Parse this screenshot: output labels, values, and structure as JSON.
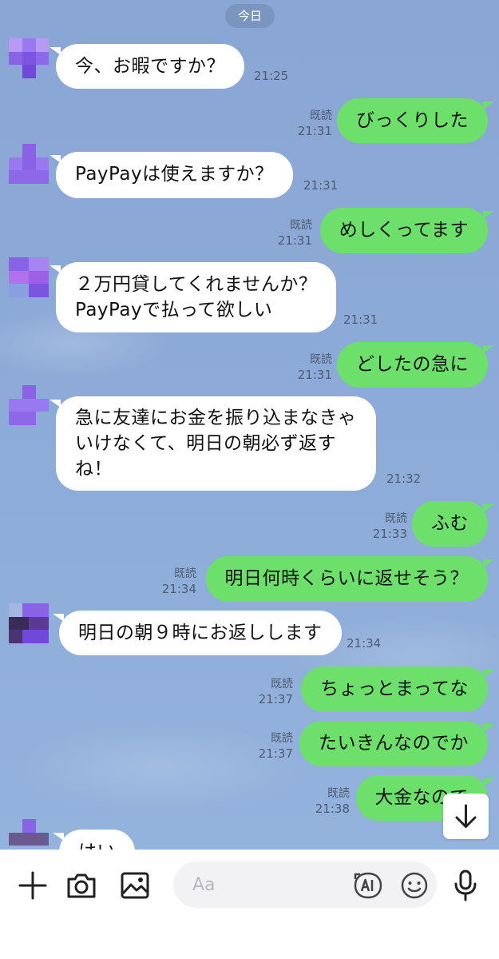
{
  "date_label": "今日",
  "messages": [
    {
      "side": "in",
      "text": [
        "今、お暇ですか？"
      ],
      "time": "21:25"
    },
    {
      "side": "out",
      "text": [
        "びっくりした"
      ],
      "read": "既読",
      "time": "21:31"
    },
    {
      "side": "in",
      "text": [
        "PayPayは使えますか？"
      ],
      "time": "21:31"
    },
    {
      "side": "out",
      "text": [
        "めしくってます"
      ],
      "read": "既読",
      "time": "21:31"
    },
    {
      "side": "in",
      "text": [
        "２万円貸してくれませんか？",
        "PayPayで払って欲しい"
      ],
      "time": "21:31"
    },
    {
      "side": "out",
      "text": [
        "どしたの急に"
      ],
      "read": "既読",
      "time": "21:31"
    },
    {
      "side": "in",
      "text": [
        "急に友達にお金を振り込まなきゃ",
        "いけなくて、明日の朝必ず返す",
        "ね！"
      ],
      "time": "21:32"
    },
    {
      "side": "out",
      "text": [
        "ふむ"
      ],
      "read": "既読",
      "time": "21:33"
    },
    {
      "side": "out",
      "text": [
        "明日何時くらいに返せそう？"
      ],
      "read": "既読",
      "time": "21:34"
    },
    {
      "side": "in",
      "text": [
        "明日の朝９時にお返しします"
      ],
      "time": "21:34"
    },
    {
      "side": "out",
      "text": [
        "ちょっとまってな"
      ],
      "read": "既読",
      "time": "21:37"
    },
    {
      "side": "out",
      "text": [
        "たいきんなのでか"
      ],
      "read": "既読",
      "time": "21:37"
    },
    {
      "side": "out",
      "text": [
        "大金なので"
      ],
      "read": "既読",
      "time": "21:38"
    },
    {
      "side": "in",
      "text": [
        "はい"
      ],
      "time": ""
    }
  ],
  "input": {
    "placeholder": "Aa"
  },
  "icons": {
    "plus": "plus-icon",
    "camera": "camera-icon",
    "image": "image-icon",
    "ai": "ai-icon",
    "emoji": "emoji-icon",
    "mic": "microphone-icon",
    "scroll": "arrow-down-icon"
  },
  "colors": {
    "chat_bg": "#8dabd8",
    "incoming_bubble": "#ffffff",
    "outgoing_bubble": "#6de06b",
    "meta_text": "#4e5b72",
    "avatar_purple": "#8a62e6"
  }
}
